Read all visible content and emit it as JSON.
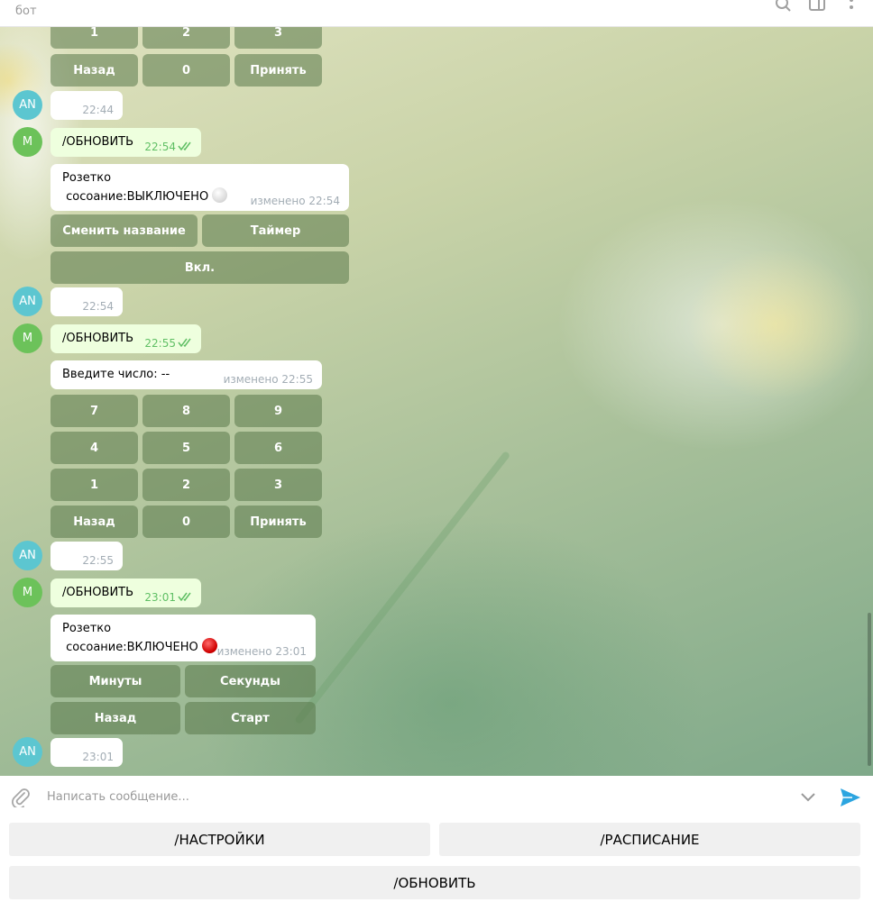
{
  "header": {
    "subtitle": "бот"
  },
  "messages": [
    {
      "time": "22:44"
    },
    {
      "text": "/ОБНОВИТЬ",
      "time": "22:54"
    },
    {
      "line1": "Розетко",
      "line2": " сосоание:ВЫКЛЮЧЕНО",
      "time": "изменено 22:54",
      "buttons": [
        "Сменить название",
        "Таймер",
        "Вкл."
      ]
    },
    {
      "time": "22:54"
    },
    {
      "text": "/ОБНОВИТЬ",
      "time": "22:55"
    },
    {
      "text": "Введите число: --",
      "time": "изменено 22:55",
      "buttons": [
        "7",
        "8",
        "9",
        "4",
        "5",
        "6",
        "1",
        "2",
        "3",
        "Назад",
        "0",
        "Принять"
      ]
    },
    {
      "time": "22:55"
    },
    {
      "text": "/ОБНОВИТЬ",
      "time": "23:01"
    },
    {
      "line1": "Розетко",
      "line2": " сосоание:ВКЛЮЧЕНО",
      "time": "изменено 23:01",
      "buttons": [
        "Минуты",
        "Секунды",
        "Назад",
        "Старт"
      ]
    },
    {
      "time": "23:01"
    }
  ],
  "top_keypad": [
    "1",
    "2",
    "3",
    "Назад",
    "0",
    "Принять"
  ],
  "avatars": {
    "user": "AN",
    "bot": "M"
  },
  "composer": {
    "placeholder": "Написать сообщение..."
  },
  "keyboard": {
    "settings": "/НАСТРОЙКИ",
    "schedule": "/РАСПИСАНИЕ",
    "refresh": "/ОБНОВИТЬ"
  },
  "icons": {
    "search": "search-icon",
    "sidebar": "sidebar-icon",
    "more": "more-vertical-icon",
    "attach": "paperclip-icon",
    "scroll": "chevron-down-icon",
    "send": "send-icon"
  },
  "colors": {
    "avatar_user": "#5cc6d0",
    "avatar_bot": "#6cc25a",
    "outgoing_bubble": "#eeffde",
    "send_accent": "#2ca5e0",
    "status_on": "#d00000"
  }
}
